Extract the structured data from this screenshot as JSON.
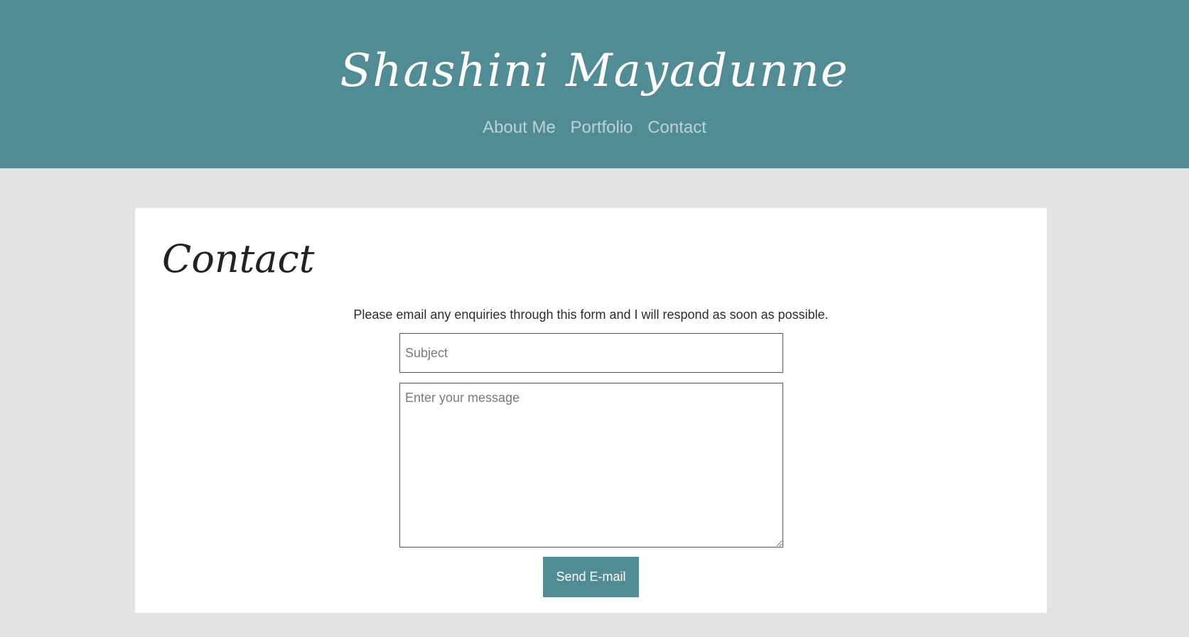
{
  "header": {
    "site_title": "Shashini Mayadunne",
    "nav": [
      "About Me",
      "Portfolio",
      "Contact"
    ]
  },
  "main": {
    "heading": "Contact",
    "intro": "Please email any enquiries through this form and I will respond as soon as possible.",
    "form": {
      "subject_placeholder": "Subject",
      "subject_value": "",
      "message_placeholder": "Enter your message",
      "message_value": "",
      "submit_label": "Send E-mail"
    }
  },
  "colors": {
    "header_bg": "#518c94",
    "page_bg": "#e3e3e3",
    "card_bg": "#ffffff",
    "nav_link": "#bcd3d6",
    "button_bg": "#518c94"
  }
}
